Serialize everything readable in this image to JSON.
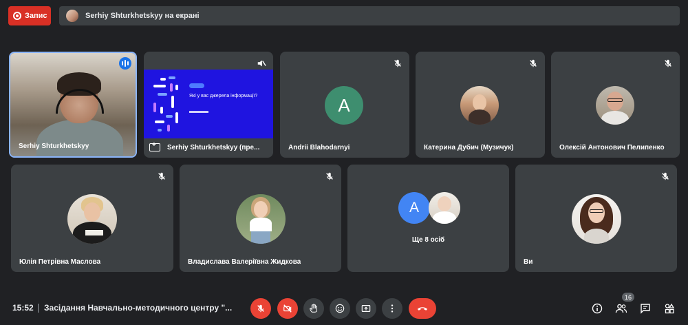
{
  "top_bar": {
    "record_label": "Запис",
    "presenting_text": "Serhiy Shturkhetskyy на екрані"
  },
  "tiles": [
    {
      "name": "Serhiy Shturkhetskyy",
      "speaking": true
    },
    {
      "name": "Serhiy Shturkhetskyy (пре...",
      "slide_title": "Які у вас джерела інформації?",
      "muted": true
    },
    {
      "name": "Andrii Blahodarnyi",
      "avatar_letter": "A",
      "avatar_color": "#3e8e6f",
      "muted": true
    },
    {
      "name": "Катерина Дубич (Музичук)",
      "muted": true
    },
    {
      "name": "Олексій Антонович Пелипенко",
      "muted": true
    },
    {
      "name": "Юлія Петрівна Маслова",
      "muted": true
    },
    {
      "name": "Владислава Валеріївна Жидкова",
      "muted": true
    },
    {
      "name": "Ще 8 осіб",
      "avatar_letter": "A",
      "avatar_color": "#4285f4"
    },
    {
      "name": "Ви",
      "muted": true
    }
  ],
  "bottom_bar": {
    "time": "15:52",
    "meeting_title": "Засідання Навчально-методичного центру \"...",
    "participants_count": "16",
    "controls": [
      "mic-off-icon",
      "camera-off-icon",
      "raise-hand-icon",
      "emoji-icon",
      "present-screen-icon",
      "more-options-icon",
      "end-call-icon"
    ],
    "right_icons": [
      "info-icon",
      "people-icon",
      "chat-icon",
      "activities-icon"
    ]
  },
  "colors": {
    "background": "#202124",
    "tile": "#3c4043",
    "accent": "#8ab4f8",
    "red": "#ea4335"
  }
}
